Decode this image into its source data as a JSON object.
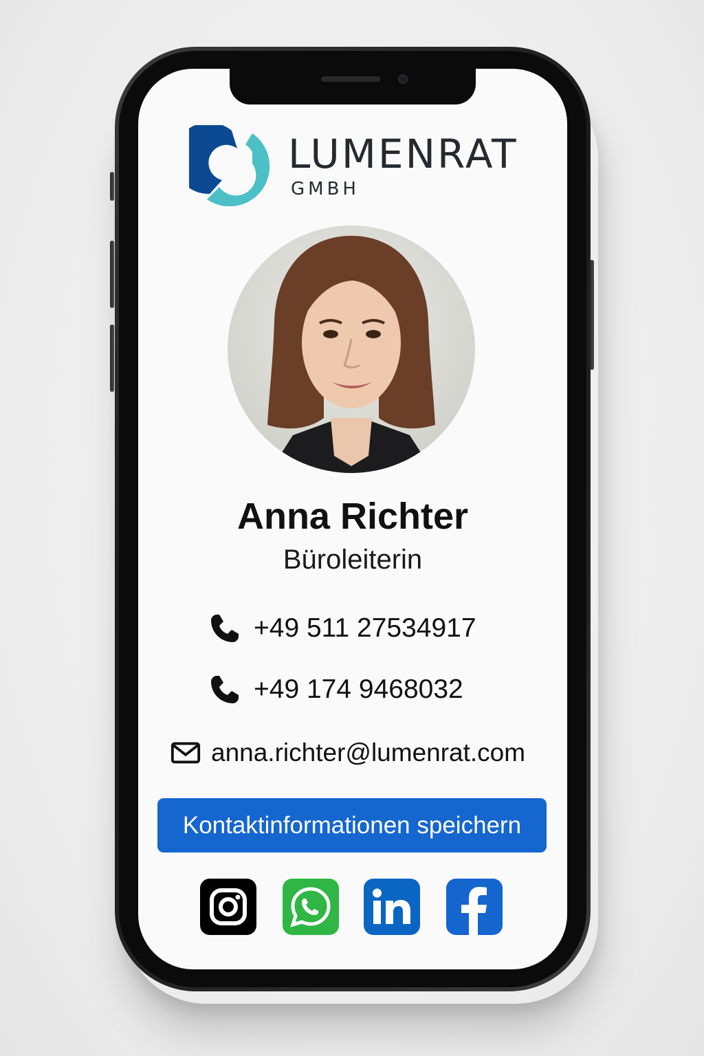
{
  "company": {
    "name": "LUMENRAT",
    "suffix": "GMBH",
    "colors": {
      "dark_blue": "#0b4a93",
      "teal": "#4cc0c7",
      "text": "#252a30"
    }
  },
  "profile": {
    "name": "Anna Richter",
    "title": "Büroleiterin",
    "avatar": "portrait-photo"
  },
  "contacts": [
    {
      "type": "phone",
      "icon": "phone-icon",
      "value": "+49 511 27534917"
    },
    {
      "type": "phone",
      "icon": "phone-icon",
      "value": "+49 174 9468032"
    },
    {
      "type": "email",
      "icon": "mail-icon",
      "value": "anna.richter@lumenrat.com"
    }
  ],
  "save_button": {
    "label": "Kontaktinformationen speichern",
    "color": "#1566cf"
  },
  "socials": [
    {
      "name": "instagram",
      "icon": "instagram-icon",
      "color": "#000000"
    },
    {
      "name": "whatsapp",
      "icon": "whatsapp-icon",
      "color": "#2fb644"
    },
    {
      "name": "linkedin",
      "icon": "linkedin-icon",
      "color": "#0a66c2"
    },
    {
      "name": "facebook",
      "icon": "facebook-icon",
      "color": "#1565cf"
    }
  ]
}
